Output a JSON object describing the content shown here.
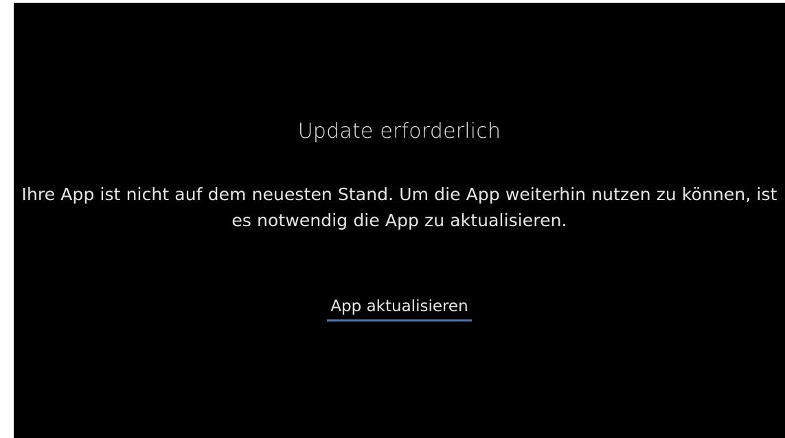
{
  "dialog": {
    "title": "Update erforderlich",
    "message": "Ihre App ist nicht auf dem neuesten Stand. Um die App weiterhin nutzen zu können, ist es notwendig die App zu aktualisieren.",
    "action_label": "App aktualisieren"
  },
  "colors": {
    "background": "#000000",
    "text": "#e6e6e6",
    "accent_underline": "#4a78b0"
  }
}
